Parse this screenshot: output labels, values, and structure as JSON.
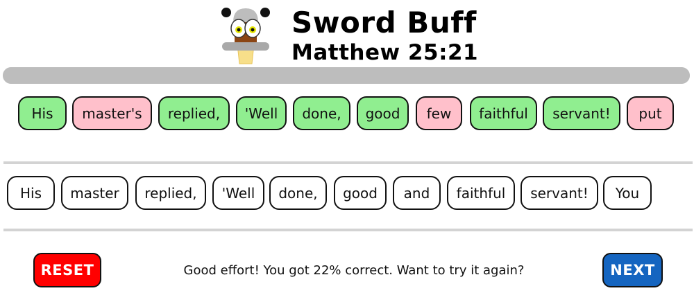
{
  "app": {
    "title": "Sword Buff",
    "reference": "Matthew 25:21"
  },
  "progress": {
    "fraction": 1.0
  },
  "answer_words": [
    {
      "text": "His",
      "status": "correct"
    },
    {
      "text": "master's",
      "status": "wrong"
    },
    {
      "text": "replied,",
      "status": "correct"
    },
    {
      "text": "'Well",
      "status": "correct"
    },
    {
      "text": "done,",
      "status": "correct"
    },
    {
      "text": "good",
      "status": "correct"
    },
    {
      "text": "few",
      "status": "wrong"
    },
    {
      "text": "faithful",
      "status": "correct"
    },
    {
      "text": "servant!",
      "status": "correct"
    },
    {
      "text": "put",
      "status": "wrong"
    }
  ],
  "target_words": [
    {
      "text": "His"
    },
    {
      "text": "master"
    },
    {
      "text": "replied,"
    },
    {
      "text": "'Well"
    },
    {
      "text": "done,"
    },
    {
      "text": "good"
    },
    {
      "text": "and"
    },
    {
      "text": "faithful"
    },
    {
      "text": "servant!"
    },
    {
      "text": "You"
    }
  ],
  "feedback": "Good effort! You got 22% correct. Want to try it again?",
  "buttons": {
    "reset_label": "RESET",
    "next_label": "NEXT"
  },
  "colors": {
    "correct": "#90ee90",
    "wrong": "#ffc0cb",
    "reset": "#ff0000",
    "next": "#1565c0",
    "track": "#d3d3d3"
  },
  "icons": {
    "mascot": "sword-mascot-icon"
  }
}
